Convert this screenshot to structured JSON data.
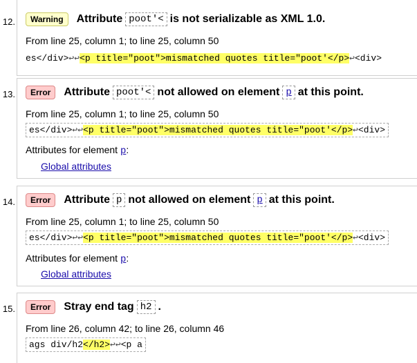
{
  "messages": [
    {
      "number": "12.",
      "badge": "Warning",
      "title_pre": "Attribute",
      "code": "poot'<",
      "title_post": "is not serializable as XML 1.0.",
      "location": "From line 25, column 1; to line 25, column 50",
      "extract_before": "es</div>",
      "extract_lf": "↩↩",
      "extract_highlight": "<p title=\"poot\">mismatched quotes title=\"poot'</p>",
      "extract_lf2": "↩",
      "extract_after": "<div>"
    },
    {
      "number": "13.",
      "badge": "Error",
      "title_pre": "Attribute",
      "code": "poot'<",
      "title_mid": "not allowed on element",
      "code2": "p",
      "title_post": "at this point.",
      "location": "From line 25, column 1; to line 25, column 50",
      "extract_before": "es</div>",
      "extract_lf": "↩↩",
      "extract_highlight": "<p title=\"poot\">mismatched quotes title=\"poot'</p>",
      "extract_lf2": "↩",
      "extract_after": "<div>",
      "attrs_label": "Attributes for element",
      "attrs_el": "p",
      "attrs_colon": ":",
      "global_link": "Global attributes"
    },
    {
      "number": "14.",
      "badge": "Error",
      "title_pre": "Attribute",
      "code": "p",
      "title_mid": "not allowed on element",
      "code2": "p",
      "title_post": "at this point.",
      "location": "From line 25, column 1; to line 25, column 50",
      "extract_before": "es</div>",
      "extract_lf": "↩↩",
      "extract_highlight": "<p title=\"poot\">mismatched quotes title=\"poot'</p>",
      "extract_lf2": "↩",
      "extract_after": "<div>",
      "attrs_label": "Attributes for element",
      "attrs_el": "p",
      "attrs_colon": ":",
      "global_link": "Global attributes"
    },
    {
      "number": "15.",
      "badge": "Error",
      "title_pre": "Stray end tag",
      "code": "h2",
      "title_post": ".",
      "location": "From line 26, column 42; to line 26, column 46",
      "extract_before": "ags div/h2",
      "extract_highlight": "</h2>",
      "extract_lf": "↩↩",
      "extract_after": "<p a"
    }
  ],
  "colors": {
    "warning_badge": "#ffffcc",
    "error_badge": "#ffcccc",
    "highlight": "#ffff66",
    "link": "#1a0dab"
  }
}
